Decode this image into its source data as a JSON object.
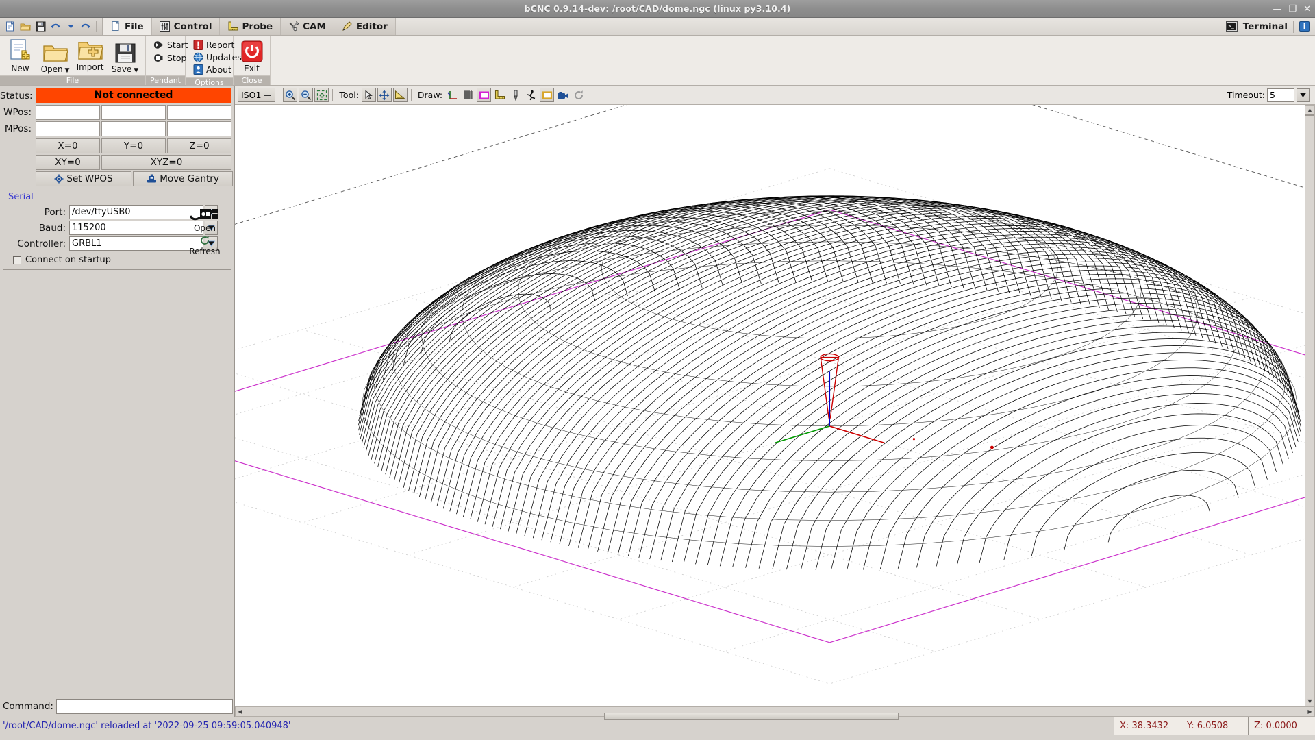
{
  "window": {
    "title": "bCNC 0.9.14-dev: /root/CAD/dome.ngc (linux py3.10.4)",
    "minimize": "—",
    "maximize": "❐",
    "close": "✕"
  },
  "quick_access": {
    "items": [
      {
        "name": "new-file-icon",
        "label": "New"
      },
      {
        "name": "open-folder-icon",
        "label": "Open"
      },
      {
        "name": "save-floppy-icon",
        "label": "Save"
      },
      {
        "name": "undo-icon",
        "label": "Undo"
      },
      {
        "name": "undo-dropdown-icon",
        "label": "Undo history"
      },
      {
        "name": "redo-icon",
        "label": "Redo"
      }
    ]
  },
  "tabs": [
    {
      "label": "File",
      "icon": "document-icon",
      "active": true
    },
    {
      "label": "Control",
      "icon": "sliders-icon",
      "active": false
    },
    {
      "label": "Probe",
      "icon": "ruler-icon",
      "active": false
    },
    {
      "label": "CAM",
      "icon": "tools-icon",
      "active": false
    },
    {
      "label": "Editor",
      "icon": "pencil-icon",
      "active": false
    }
  ],
  "tabs_right": {
    "terminal_label": "Terminal",
    "terminal_icon": "terminal-icon",
    "info_icon": "info-icon"
  },
  "ribbon": {
    "groups": [
      {
        "label": "File",
        "buttons": [
          {
            "label": "New",
            "icon": "new-document-icon",
            "dropdown": false
          },
          {
            "label": "Open",
            "icon": "open-folder-icon",
            "dropdown": true
          },
          {
            "label": "Import",
            "icon": "import-folder-icon",
            "dropdown": false
          },
          {
            "label": "Save",
            "icon": "save-floppy-icon",
            "dropdown": true
          }
        ]
      },
      {
        "label": "Pendant",
        "small_buttons": [
          {
            "label": "Start",
            "icon": "play-start-icon"
          },
          {
            "label": "Stop",
            "icon": "stop-icon"
          }
        ]
      },
      {
        "label": "Options",
        "small_buttons": [
          {
            "label": "Report",
            "icon": "report-warning-icon"
          },
          {
            "label": "Updates",
            "icon": "globe-updates-icon"
          },
          {
            "label": "About",
            "icon": "about-person-icon"
          }
        ]
      },
      {
        "label": "Close",
        "buttons": [
          {
            "label": "Exit",
            "icon": "power-exit-icon",
            "dropdown": false
          }
        ]
      }
    ]
  },
  "left_panel": {
    "status_label": "Status:",
    "status_value": "Not connected",
    "status_color": "#ff4500",
    "wpos_label": "WPos:",
    "mpos_label": "MPos:",
    "wpos_values": [
      "",
      "",
      ""
    ],
    "mpos_values": [
      "",
      "",
      ""
    ],
    "zero_buttons": [
      "X=0",
      "Y=0",
      "Z=0"
    ],
    "zero_buttons_2": [
      "XY=0",
      "XYZ=0"
    ],
    "set_wpos_label": "Set WPOS",
    "set_wpos_icon": "crosshair-icon",
    "move_gantry_label": "Move Gantry",
    "move_gantry_icon": "gantry-icon",
    "serial": {
      "legend": "Serial",
      "port_label": "Port:",
      "port_value": "/dev/ttyUSB0",
      "baud_label": "Baud:",
      "baud_value": "115200",
      "controller_label": "Controller:",
      "controller_value": "GRBL1",
      "connect_on_startup_label": "Connect on startup",
      "connect_on_startup_checked": false,
      "open_label": "Open",
      "open_icon": "usb-plug-icon",
      "refresh_label": "Refresh",
      "refresh_icon": "refresh-icon"
    },
    "command_label": "Command:",
    "command_value": "",
    "command_placeholder": ""
  },
  "cnc_toolbar": {
    "view_preset": "ISO1",
    "view_preset_icon": "chevron-down-icon",
    "zoom_in_icon": "zoom-in-icon",
    "zoom_out_icon": "zoom-out-icon",
    "zoom_fit_icon": "zoom-fit-icon",
    "tool_label": "Tool:",
    "tool_buttons": [
      {
        "name": "select-arrow-icon"
      },
      {
        "name": "pan-move-icon"
      },
      {
        "name": "ruler-measure-icon"
      }
    ],
    "draw_label": "Draw:",
    "draw_buttons": [
      {
        "name": "axes-icon"
      },
      {
        "name": "grid-icon"
      },
      {
        "name": "margin-box-icon"
      },
      {
        "name": "ruler-icon"
      },
      {
        "name": "endmill-icon"
      },
      {
        "name": "path-rapid-icon"
      },
      {
        "name": "workarea-icon"
      },
      {
        "name": "camera-icon"
      },
      {
        "name": "probe-circle-icon"
      }
    ],
    "timeout_label": "Timeout:",
    "timeout_value": "5",
    "timeout_dropdown_icon": "chevron-down-icon"
  },
  "canvas": {
    "name": "gcode-3d-view",
    "description": "ISO1 wireframe view of dome.ngc toolpath",
    "background": "#ffffff",
    "path_color": "#000000",
    "margin_color": "#cc33cc",
    "axis_x_color": "#cc0000",
    "axis_y_color": "#009900",
    "axis_z_color": "#0000cc",
    "tool_color": "#cc0000",
    "grid_color": "#cccccc"
  },
  "status_bar": {
    "message": "'/root/CAD/dome.ngc' reloaded at '2022-09-25 09:59:05.040948'",
    "coordinates": [
      {
        "label": "X:",
        "value": "38.3432"
      },
      {
        "label": "Y:",
        "value": "6.0508"
      },
      {
        "label": "Z:",
        "value": "0.0000"
      }
    ]
  },
  "scrollbars": {
    "horizontal_name": "canvas-hscrollbar",
    "vertical_name": "canvas-vscrollbar"
  }
}
